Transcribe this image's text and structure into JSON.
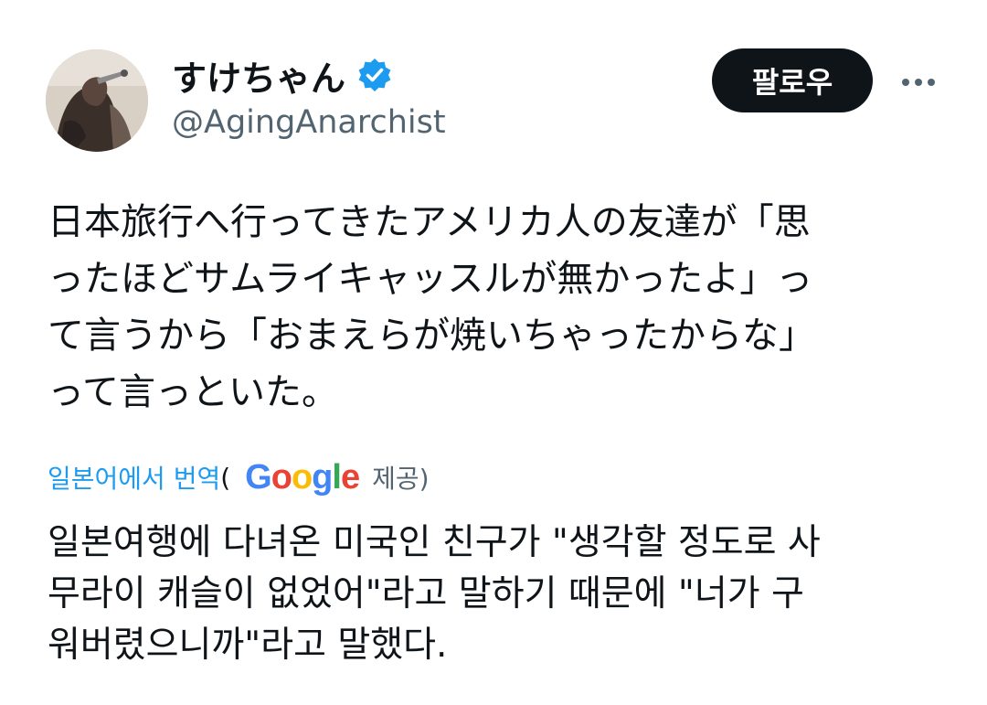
{
  "author": {
    "display_name": "すけちゃん",
    "handle": "@AgingAnarchist",
    "verified": true
  },
  "actions": {
    "follow_label": "팔로우",
    "more_icon": "more-horizontal-icon"
  },
  "tweet": {
    "lines": [
      "日本旅行へ行ってきたアメリカ人の友達が「思",
      "ったほどサムライキャッスルが無かったよ」っ",
      "て言うから「おまえらが焼いちゃったからな」",
      "って言っといた。"
    ]
  },
  "translation": {
    "link_label": "일본어에서 번역",
    "paren_open": "(",
    "provider_logo_text": "Google",
    "provided_label": "제공)",
    "lines": [
      "일본여행에 다녀온 미국인 친구가 \"생각할 정도로 사",
      "무라이 캐슬이 없었어\"라고 말하기 때문에 \"너가 구",
      "워버렸으니까\"라고 말했다."
    ]
  },
  "colors": {
    "accent": "#1d9bf0",
    "text": "#0f1419",
    "secondary_text": "#536471",
    "follow_bg": "#0f1419"
  }
}
